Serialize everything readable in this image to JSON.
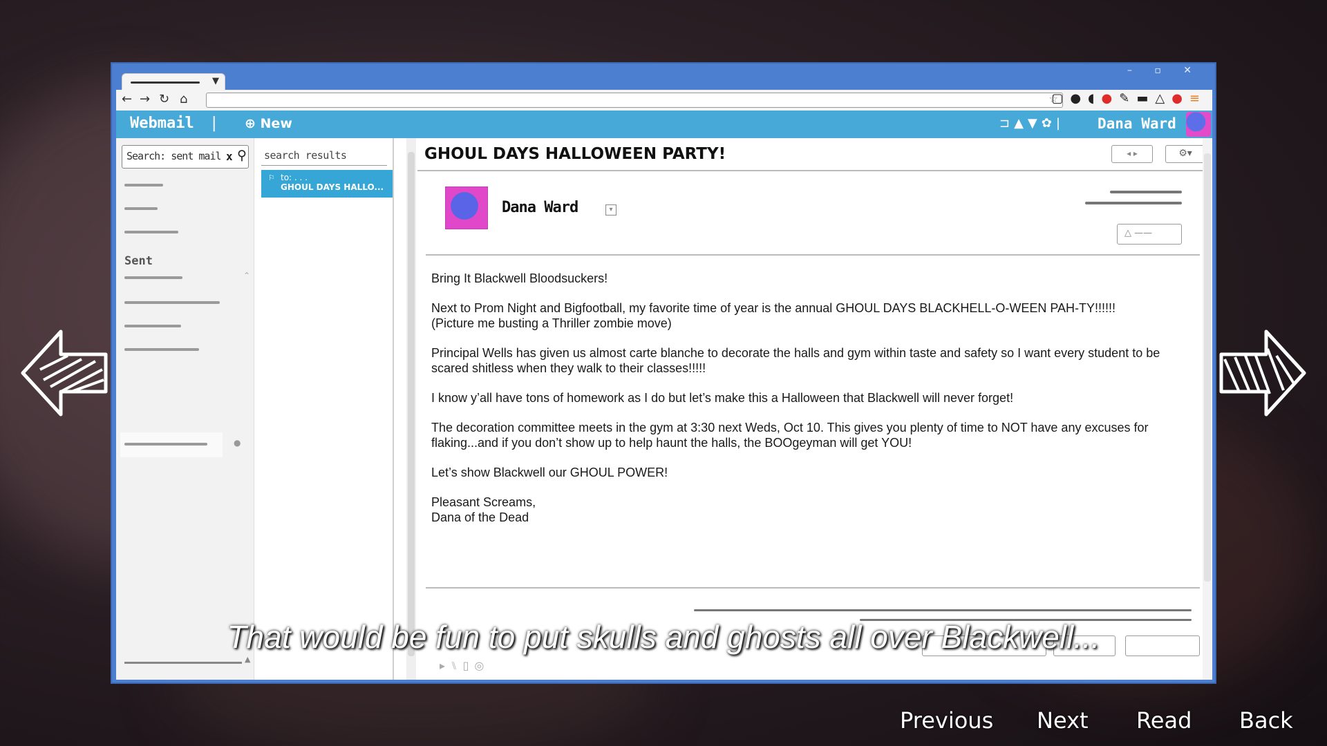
{
  "browser": {
    "window_controls": "– ▫ ✕",
    "tab_close": "▼"
  },
  "app": {
    "title": "Webmail",
    "separator": "|",
    "new_button": "⊕ New",
    "user_name": "Dana Ward"
  },
  "sidebar": {
    "search_text": "Search: sent mail",
    "search_clear": "x",
    "sent_label": "Sent"
  },
  "message_list": {
    "header": "search results",
    "items": [
      {
        "to": "to: . . .",
        "subject": "GHOUL DAYS HALLO..."
      }
    ]
  },
  "email": {
    "subject": "GHOUL DAYS HALLOWEEN PARTY!",
    "sender": "Dana Ward",
    "body": [
      "Bring It Blackwell Bloodsuckers!",
      "Next to Prom Night and Bigfootball, my favorite time of year is the annual GHOUL DAYS BLACKHELL-O-WEEN PAH-TY!!!!!!\n(Picture me busting a Thriller zombie move)",
      "Principal Wells has given us almost carte blanche to decorate the halls and gym within taste and safety so I want every student to be scared shitless when they walk to their classes!!!!!",
      "I know y’all have tons of homework as I do but let’s make this a Halloween that Blackwell will never forget!",
      "The decoration committee meets in the gym at 3:30 next Weds, Oct 10. This gives you plenty of time to NOT have any excuses for flaking...and if you don’t show up to help haunt the halls, the BOOgeyman will get YOU!",
      "Let’s show Blackwell our GHOUL POWER!",
      "Pleasant Screams,\nDana of the Dead"
    ]
  },
  "subtitle": "That would be fun to put skulls and ghosts all over Blackwell...",
  "menu": {
    "previous": "Previous",
    "next": "Next",
    "read": "Read",
    "back": "Back"
  },
  "colors": {
    "window_frame": "#4d7fd0",
    "app_bar": "#47a9d8",
    "selected_item": "#35a6d6",
    "avatar_pink": "#e048c9",
    "avatar_blue": "#5a64e6"
  }
}
